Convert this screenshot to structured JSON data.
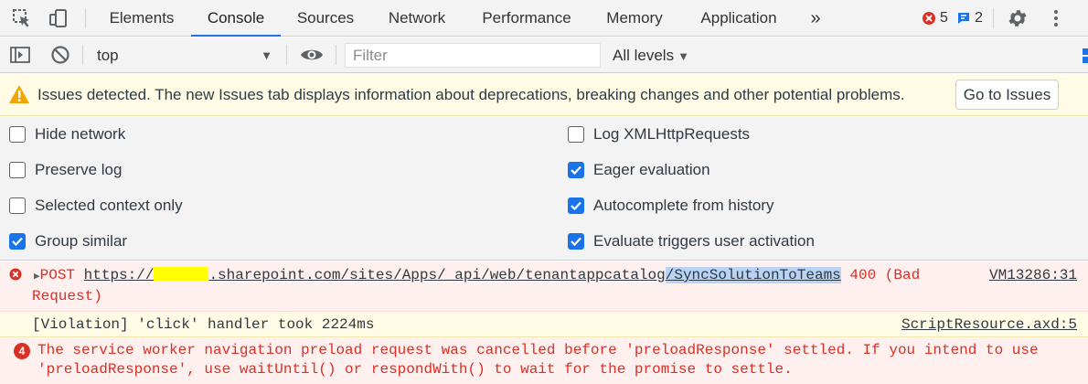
{
  "tabs": [
    "Elements",
    "Console",
    "Sources",
    "Network",
    "Performance",
    "Memory",
    "Application"
  ],
  "active_tab": "Console",
  "counters": {
    "errors": "5",
    "messages": "2"
  },
  "toolbar": {
    "context": "top",
    "filter_placeholder": "Filter",
    "levels": "All levels"
  },
  "issues_banner": {
    "text": "Issues detected. The new Issues tab displays information about deprecations, breaking changes and other potential problems.",
    "button": "Go to Issues"
  },
  "settings": {
    "left": [
      {
        "label": "Hide network",
        "checked": false
      },
      {
        "label": "Preserve log",
        "checked": false
      },
      {
        "label": "Selected context only",
        "checked": false
      },
      {
        "label": "Group similar",
        "checked": true
      }
    ],
    "right": [
      {
        "label": "Log XMLHttpRequests",
        "checked": false
      },
      {
        "label": "Eager evaluation",
        "checked": true
      },
      {
        "label": "Autocomplete from history",
        "checked": true
      },
      {
        "label": "Evaluate triggers user activation",
        "checked": true
      }
    ]
  },
  "messages": {
    "error": {
      "method": "POST",
      "url_start": "https://",
      "url_mid": ".sharepoint.com/sites/Apps/_api/web/tenantappcatalog",
      "url_end": "/SyncSolutionToTeams",
      "status": "400 (Bad",
      "status2": "Request)",
      "source": "VM13286:31"
    },
    "violation": {
      "text": "[Violation] 'click' handler took 2224ms",
      "source": "ScriptResource.axd:5"
    },
    "sw_error": {
      "count": "4",
      "line1": "The service worker navigation preload request was cancelled before 'preloadResponse' settled. If you intend to use",
      "line2": "'preloadResponse', use waitUntil() or respondWith() to wait for the promise to settle."
    }
  },
  "colors": {
    "accent": "#1a73e8",
    "error": "#d93025",
    "warning_bg": "#fffbe5",
    "error_bg": "#fef0ef"
  }
}
